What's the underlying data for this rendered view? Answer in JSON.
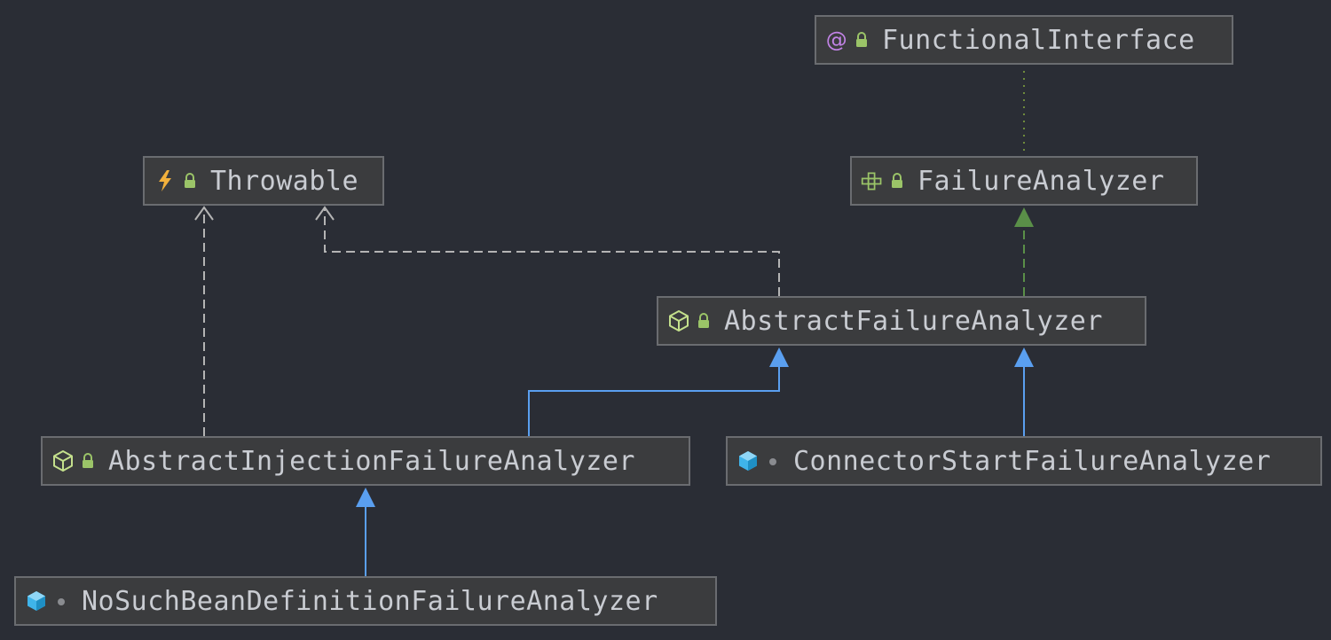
{
  "diagram": {
    "nodes": [
      {
        "id": "functional-interface",
        "label": "FunctionalInterface",
        "kind": "annotation",
        "visibility": "public",
        "kind_icon": "at-sign-icon",
        "visibility_icon": "lock-icon"
      },
      {
        "id": "failure-analyzer",
        "label": "FailureAnalyzer",
        "kind": "interface",
        "visibility": "public",
        "kind_icon": "interface-icon",
        "visibility_icon": "lock-icon"
      },
      {
        "id": "throwable",
        "label": "Throwable",
        "kind": "exception",
        "visibility": "public",
        "kind_icon": "lightning-icon",
        "visibility_icon": "lock-icon"
      },
      {
        "id": "abstract-failure-analyzer",
        "label": "AbstractFailureAnalyzer",
        "kind": "abstract-class",
        "visibility": "public",
        "kind_icon": "abstract-class-icon",
        "visibility_icon": "lock-icon"
      },
      {
        "id": "abstract-injection-failure-analyzer",
        "label": "AbstractInjectionFailureAnalyzer",
        "kind": "abstract-class",
        "visibility": "public",
        "kind_icon": "abstract-class-icon",
        "visibility_icon": "lock-icon"
      },
      {
        "id": "connector-start-failure-analyzer",
        "label": "ConnectorStartFailureAnalyzer",
        "kind": "class",
        "visibility": "package",
        "kind_icon": "class-icon",
        "visibility_icon": "dot-icon"
      },
      {
        "id": "no-such-bean-definition-failure-analyzer",
        "label": "NoSuchBeanDefinitionFailureAnalyzer",
        "kind": "class",
        "visibility": "package",
        "kind_icon": "class-icon",
        "visibility_icon": "dot-icon"
      }
    ],
    "edges": [
      {
        "from": "failure-analyzer",
        "to": "functional-interface",
        "type": "annotated-by"
      },
      {
        "from": "abstract-failure-analyzer",
        "to": "failure-analyzer",
        "type": "implements"
      },
      {
        "from": "abstract-failure-analyzer",
        "to": "throwable",
        "type": "uses"
      },
      {
        "from": "abstract-injection-failure-analyzer",
        "to": "throwable",
        "type": "uses"
      },
      {
        "from": "abstract-injection-failure-analyzer",
        "to": "abstract-failure-analyzer",
        "type": "extends"
      },
      {
        "from": "connector-start-failure-analyzer",
        "to": "abstract-failure-analyzer",
        "type": "extends"
      },
      {
        "from": "no-such-bean-definition-failure-analyzer",
        "to": "abstract-injection-failure-analyzer",
        "type": "extends"
      }
    ]
  },
  "colors": {
    "background": "#2a2d35",
    "node_fill": "#3b3c3e",
    "node_border": "#6a6c70",
    "text": "#c9ccd2",
    "extends_edge": "#5a9ff0",
    "implements_edge": "#5a8f48",
    "uses_edge": "#b4b4b4",
    "annotation_edge": "#6e8a3c",
    "lock": "#9bc468",
    "annotation_icon": "#c283e6",
    "lightning_icon": "#f2b13c",
    "class_icon": "#3fb4ea"
  }
}
